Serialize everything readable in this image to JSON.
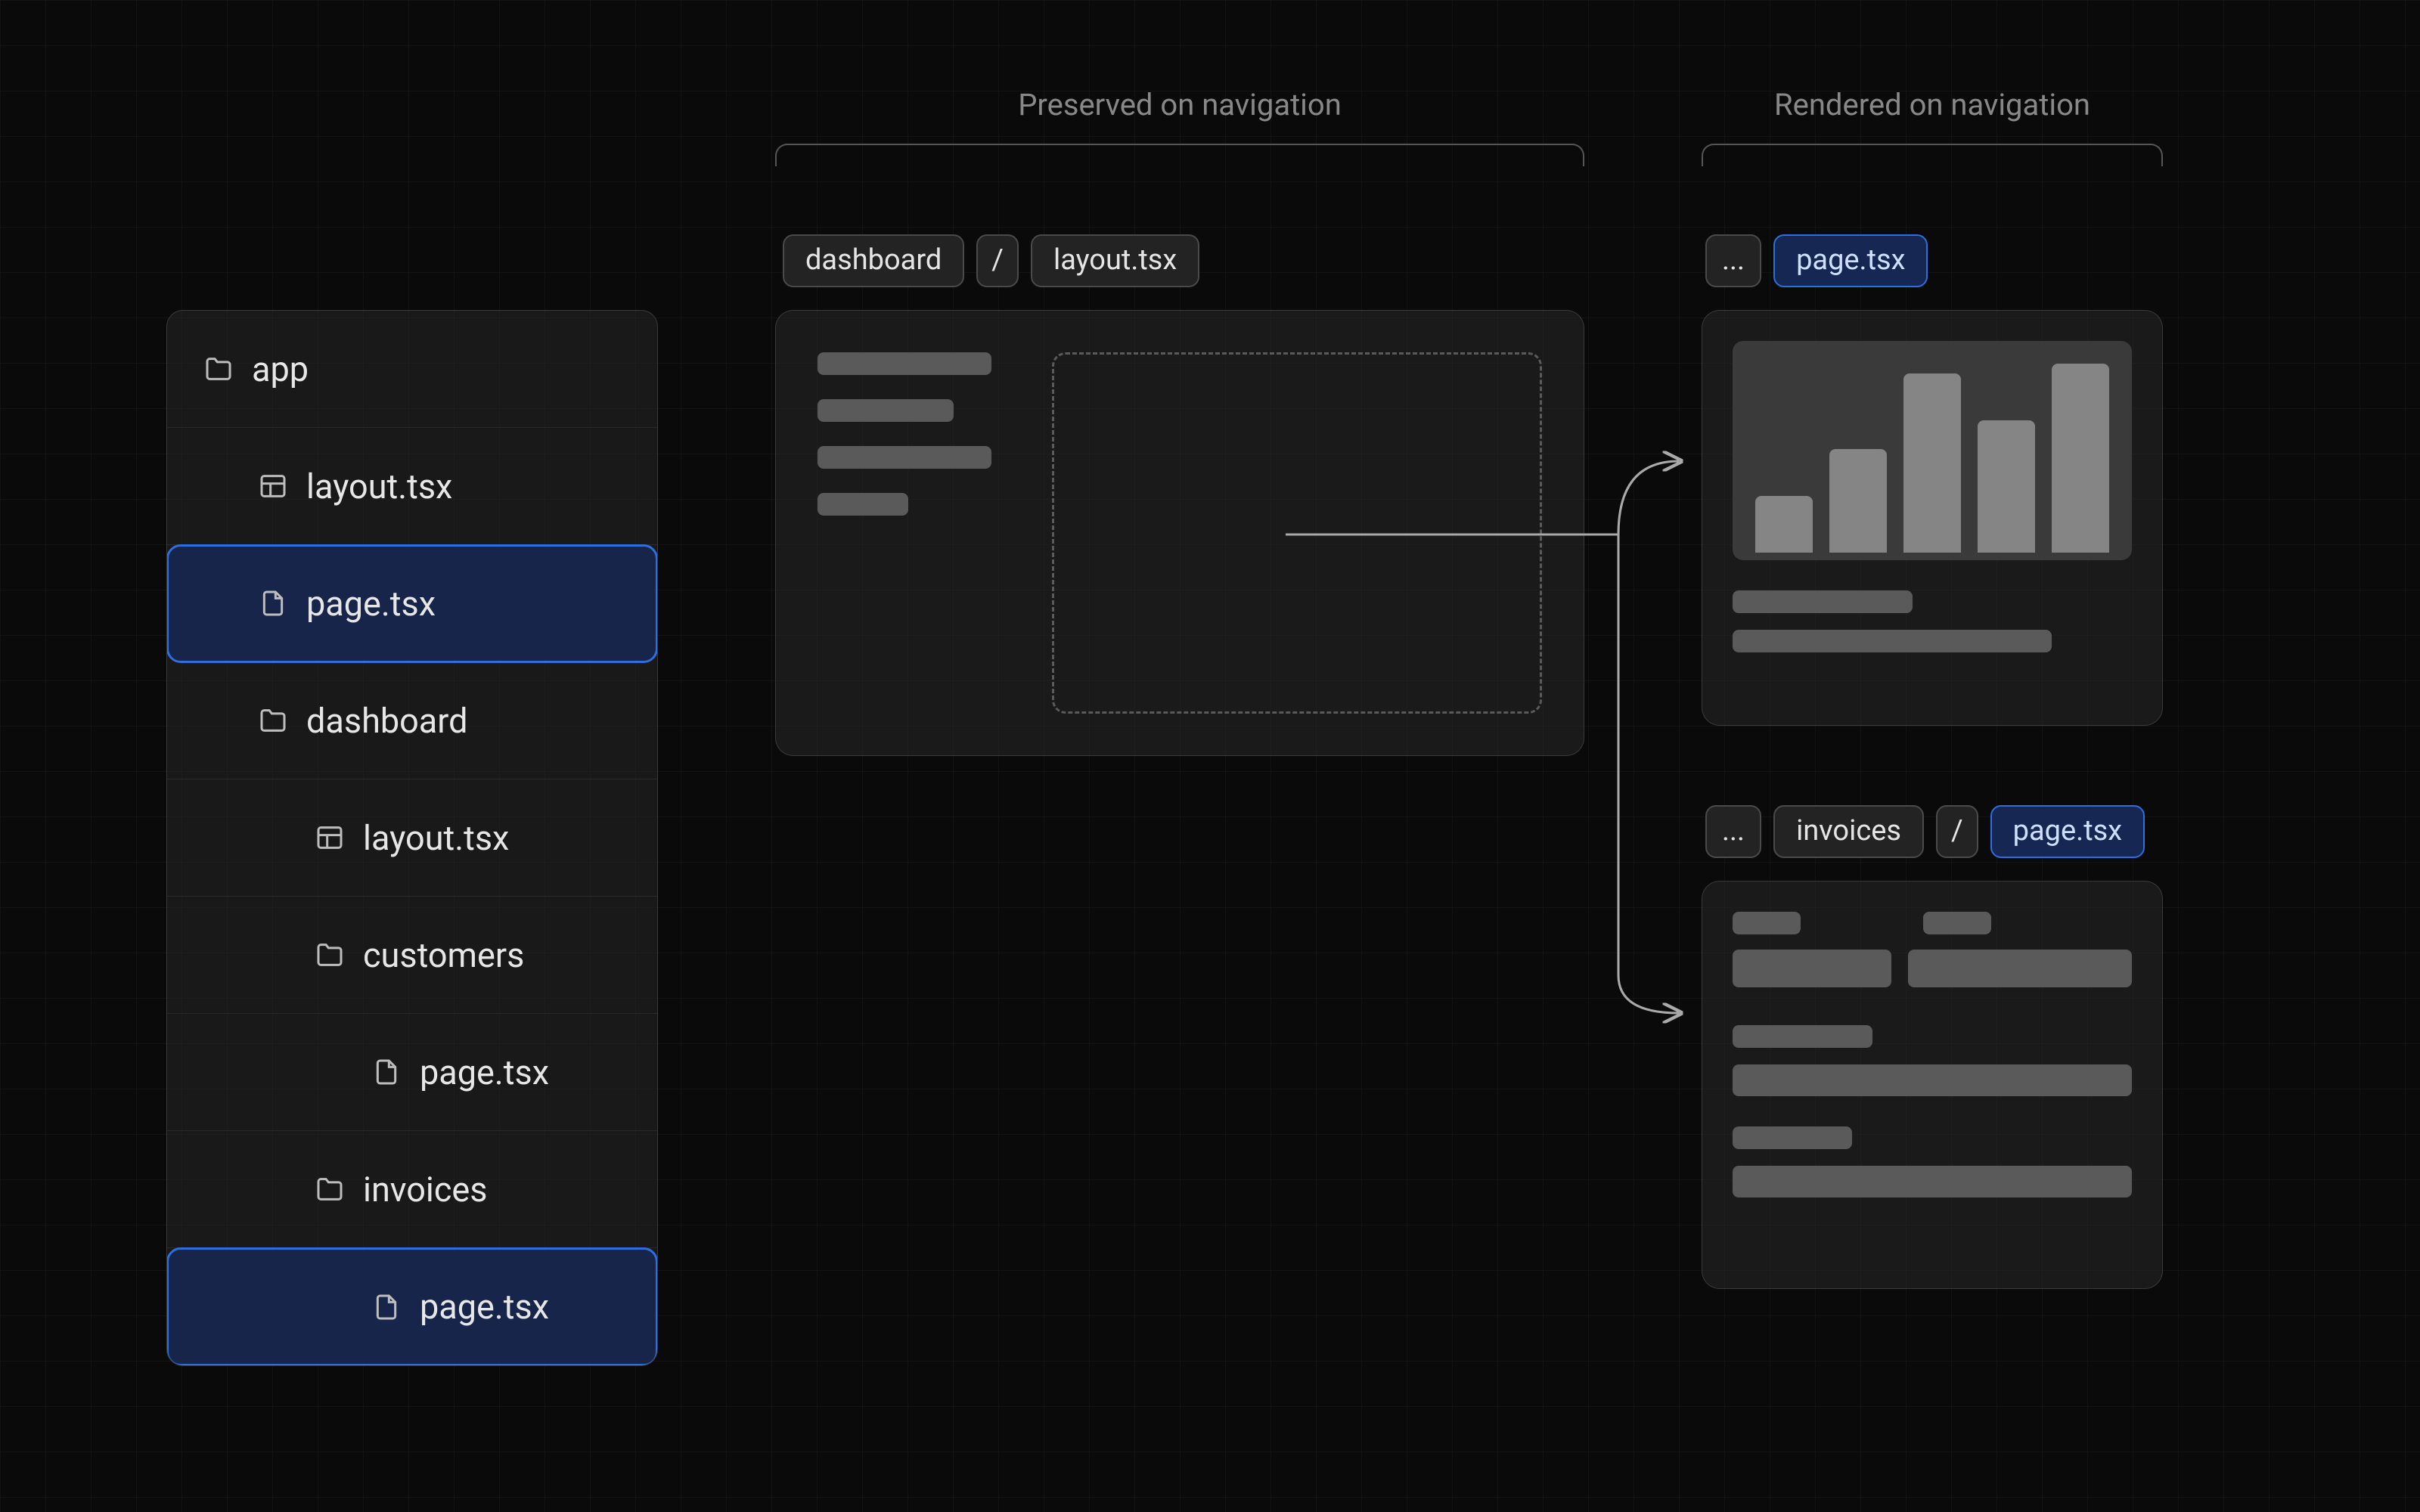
{
  "headers": {
    "preserved": "Preserved on navigation",
    "rendered": "Rendered on navigation"
  },
  "filetree": {
    "items": [
      {
        "label": "app",
        "icon": "folder",
        "depth": 0,
        "highlight": false
      },
      {
        "label": "layout.tsx",
        "icon": "layout",
        "depth": 1,
        "highlight": false
      },
      {
        "label": "page.tsx",
        "icon": "file",
        "depth": 1,
        "highlight": true
      },
      {
        "label": "dashboard",
        "icon": "folder",
        "depth": 1,
        "highlight": false
      },
      {
        "label": "layout.tsx",
        "icon": "layout",
        "depth": 2,
        "highlight": false
      },
      {
        "label": "customers",
        "icon": "folder",
        "depth": 2,
        "highlight": false
      },
      {
        "label": "page.tsx",
        "icon": "file",
        "depth": 3,
        "highlight": false
      },
      {
        "label": "invoices",
        "icon": "folder",
        "depth": 2,
        "highlight": false
      },
      {
        "label": "page.tsx",
        "icon": "file",
        "depth": 3,
        "highlight": true
      }
    ]
  },
  "breadcrumbs": {
    "layout": [
      {
        "text": "dashboard"
      },
      {
        "text": "/",
        "sep": true
      },
      {
        "text": "layout.tsx"
      }
    ],
    "page_dashboard": [
      {
        "text": "...",
        "ellipsis": true
      },
      {
        "text": "page.tsx",
        "active": true
      }
    ],
    "page_invoices": [
      {
        "text": "...",
        "ellipsis": true
      },
      {
        "text": "invoices"
      },
      {
        "text": "/",
        "sep": true
      },
      {
        "text": "page.tsx",
        "active": true
      }
    ]
  },
  "colors": {
    "highlight_border": "#2c6fdd",
    "highlight_fill": "#16285a"
  },
  "chart_data": {
    "type": "bar",
    "title": "",
    "xlabel": "",
    "ylabel": "",
    "categories": [
      "",
      "",
      "",
      "",
      ""
    ],
    "values": [
      30,
      55,
      95,
      70,
      100
    ],
    "ylim": [
      0,
      100
    ]
  }
}
